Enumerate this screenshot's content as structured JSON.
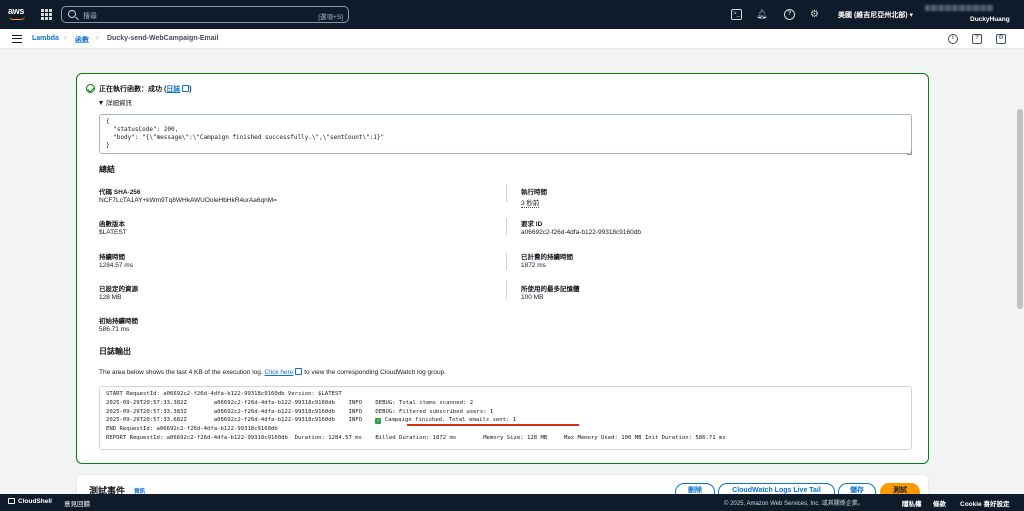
{
  "topnav": {
    "logo": "aws",
    "search_placeholder": "搜尋",
    "search_shortcut": "[選項+S]",
    "region": "美國 (維吉尼亞州北部) ▾",
    "user": "DuckyHuang",
    "icons": [
      "grid-icon",
      "cloudshell-icon",
      "bell-icon",
      "help-icon",
      "gear-icon"
    ]
  },
  "breadcrumb": {
    "items": [
      "Lambda",
      "函數",
      "Ducky-send-WebCampaign-Email"
    ],
    "separator": "›"
  },
  "result": {
    "status_prefix": "正在執行函數：成功 (",
    "log_link": "日誌",
    "status_suffix": ")",
    "details_label": "詳細資訊",
    "response": "{\n  \"statusCode\": 200,\n  \"body\": \"{\\\"message\\\":\\\"Campaign finished successfully.\\\",\\\"sentCount\\\":1}\"\n}"
  },
  "summary": {
    "title": "總結",
    "code_sha_label": "代碼 SHA-256",
    "code_sha": "NCF7LcTA1AY+kWm9Tq8WHkAWUOoleHbHkR4urAa6qnM=",
    "exec_time_label": "執行時間",
    "exec_time": "3 秒前",
    "version_label": "函數版本",
    "version": "$LATEST",
    "request_id_label": "要求 ID",
    "request_id": "a06692c2-f26d-4dfa-b122-99318c9160db",
    "duration_label": "持續時間",
    "duration": "1284.57 ms",
    "billed_label": "已計費的持續時間",
    "billed": "1872 ms",
    "resources_label": "已設定的資源",
    "resources": "128 MB",
    "max_mem_label": "所使用的最多記憶體",
    "max_mem": "100 MB",
    "init_label": "初始持續時間",
    "init": "586.71 ms"
  },
  "log": {
    "title": "日誌輸出",
    "desc_before": "The area below shows the last 4 KB of the execution log.",
    "desc_link": "Click here",
    "desc_after": "to view the corresponding CloudWatch log group.",
    "lines_before": "START RequestId: a06692c2-f26d-4dfa-b122-99318c9160db Version: $LATEST\n2025-09-29T20:57:33.382Z\ta06692c2-f26d-4dfa-b122-99318c9160db\tINFO\tDEBUG: Total items scanned: 2\n2025-09-29T20:57:33.383Z\ta06692c2-f26d-4dfa-b122-99318c9160db\tINFO\tDEBUG: Filtered subscribed users: 1\n2025-09-29T20:57:33.682Z\ta06692c2-f26d-4dfa-b122-99318c9160db\tINFO\t",
    "highlight": "Campaign finished. Total emails sent: 1",
    "lines_after": "\nEND RequestId: a06692c2-f26d-4dfa-b122-99318c9160db\nREPORT RequestId: a06692c2-f26d-4dfa-b122-99318c9160db  Duration: 1284.57 ms\tBilled Duration: 1872 ms\tMemory Size: 128 MB\tMax Memory Used: 100 MB Init Duration: 586.71 ms"
  },
  "test_event": {
    "title": "測試事件",
    "info": "資訊",
    "delete": "刪除",
    "cloudwatch": "CloudWatch Logs Live Tail",
    "save": "儲存",
    "test": "測試"
  },
  "footer": {
    "cloudshell": "CloudShell",
    "feedback": "意見回饋",
    "copyright": "© 2025, Amazon Web Services, Inc. 或其關係企業。",
    "privacy": "隱私權",
    "terms": "條款",
    "cookies": "Cookie 喜好設定"
  },
  "colors": {
    "nav_bg": "#0f1b2a",
    "success": "#037f0c",
    "link": "#0972d3",
    "primary": "#ff9900"
  }
}
